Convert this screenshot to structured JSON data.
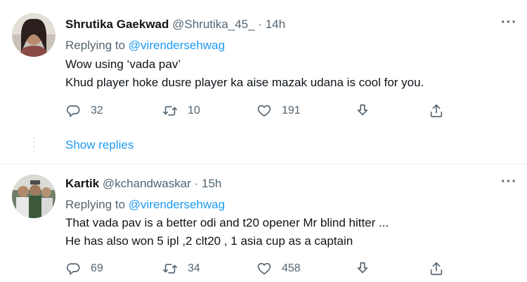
{
  "tweets": [
    {
      "author_name": "Shrutika Gaekwad",
      "handle": "@Shrutika_45_",
      "separator": "·",
      "time": "14h",
      "replying_prefix": "Replying to",
      "replying_to": "@virendersehwag",
      "lines": [
        "Wow using ‘vada pav’",
        "Khud player hoke dusre player ka aise mazak udana is cool for you."
      ],
      "replies": "32",
      "retweets": "10",
      "likes": "191",
      "show_replies": "Show replies"
    },
    {
      "author_name": "Kartik",
      "handle": "@kchandwaskar",
      "separator": "·",
      "time": "15h",
      "replying_prefix": "Replying to",
      "replying_to": "@virendersehwag",
      "lines": [
        "That vada pav is a better odi and t20 opener Mr blind hitter ...",
        "He has also won 5 ipl ,2 clt20 , 1 asia cup as a captain"
      ],
      "replies": "69",
      "retweets": "34",
      "likes": "458"
    }
  ],
  "more_glyph": "···",
  "icons": {
    "reply": "reply-icon",
    "retweet": "retweet-icon",
    "like": "heart-icon",
    "download": "download-icon",
    "share": "share-icon",
    "more": "more-icon"
  },
  "colors": {
    "link": "#1d9bf0",
    "text": "#0f1419",
    "secondary": "#536471",
    "divider": "#e6ecf0"
  }
}
